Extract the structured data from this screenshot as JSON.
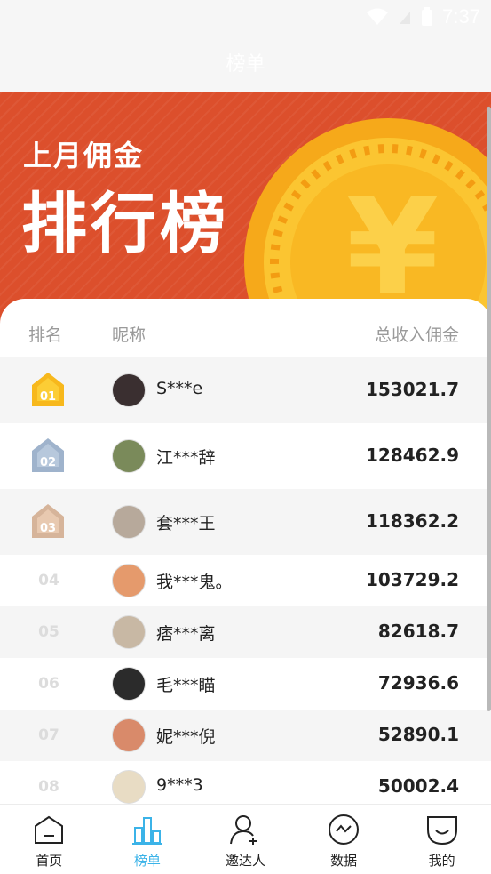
{
  "status": {
    "time": "7:37"
  },
  "header": {
    "title": "榜单"
  },
  "banner": {
    "subtitle": "上月佣金",
    "title": "排行榜"
  },
  "table": {
    "columns": {
      "rank": "排名",
      "nickname": "昵称",
      "total": "总收入佣金"
    },
    "rows": [
      {
        "rank": "01",
        "nickname": "S***e",
        "amount": "153021.7",
        "badge": "gold"
      },
      {
        "rank": "02",
        "nickname": "江***辞",
        "amount": "128462.9",
        "badge": "silver"
      },
      {
        "rank": "03",
        "nickname": "套***王",
        "amount": "118362.2",
        "badge": "bronze"
      },
      {
        "rank": "04",
        "nickname": "我***鬼。",
        "amount": "103729.2"
      },
      {
        "rank": "05",
        "nickname": "痞***离",
        "amount": "82618.7"
      },
      {
        "rank": "06",
        "nickname": "毛***瞄",
        "amount": "72936.6"
      },
      {
        "rank": "07",
        "nickname": "妮***倪",
        "amount": "52890.1"
      },
      {
        "rank": "08",
        "nickname": "9***3",
        "amount": "50002.4"
      }
    ]
  },
  "tabs": [
    {
      "label": "首页",
      "icon": "home-icon"
    },
    {
      "label": "榜单",
      "icon": "chart-icon",
      "active": true
    },
    {
      "label": "邀达人",
      "icon": "add-user-icon"
    },
    {
      "label": "数据",
      "icon": "data-icon"
    },
    {
      "label": "我的",
      "icon": "profile-icon"
    }
  ],
  "colors": {
    "banner": "#dc4f2c",
    "accent": "#3bb3e8",
    "coin": "#f7b51c"
  }
}
